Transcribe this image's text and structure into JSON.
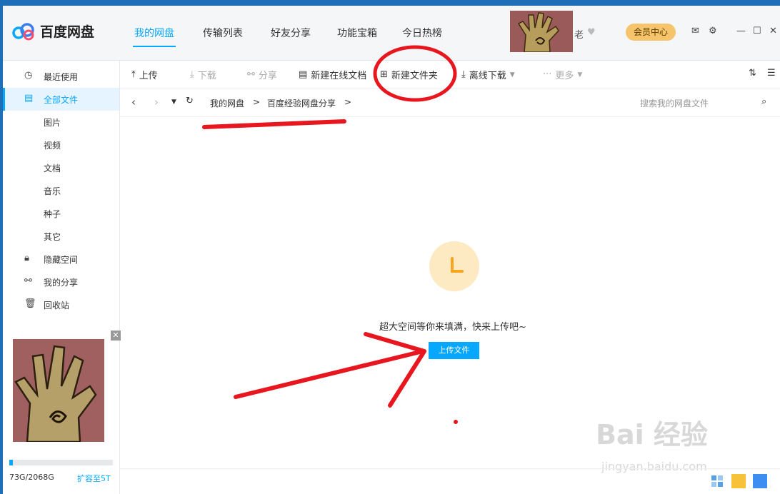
{
  "app": {
    "title": "百度网盘"
  },
  "nav": {
    "tabs": [
      "我的网盘",
      "传输列表",
      "好友分享",
      "功能宝箱",
      "今日热榜"
    ],
    "active": 0
  },
  "user": {
    "name": "老",
    "member_button": "会员中心"
  },
  "toolbar": {
    "upload": "上传",
    "download": "下载",
    "share": "分享",
    "new_doc": "新建在线文档",
    "new_folder": "新建文件夹",
    "offline_download": "离线下载",
    "more": "更多"
  },
  "path": {
    "crumbs": [
      "我的网盘",
      "百度经验网盘分享"
    ],
    "search_placeholder": "搜索我的网盘文件"
  },
  "sidebar": {
    "items": [
      {
        "label": "最近使用",
        "icon": "clock-icon"
      },
      {
        "label": "全部文件",
        "icon": "file-icon",
        "active": true
      },
      {
        "label": "图片"
      },
      {
        "label": "视频"
      },
      {
        "label": "文档"
      },
      {
        "label": "音乐"
      },
      {
        "label": "种子"
      },
      {
        "label": "其它"
      },
      {
        "label": "隐藏空间",
        "icon": "lock-icon"
      },
      {
        "label": "我的分享",
        "icon": "share-icon"
      },
      {
        "label": "回收站",
        "icon": "trash-icon"
      }
    ],
    "quota": {
      "used": "73G/2068G",
      "expand_link": "扩容至5T",
      "fraction": 0.035
    }
  },
  "main": {
    "empty_message": "超大空间等你来填满，快来上传吧~",
    "upload_button": "上传文件"
  },
  "watermark": {
    "text": "Bai 经验",
    "url": "jingyan.baidu.com"
  },
  "colors": {
    "accent": "#06a7ff",
    "member": "#f5c46b",
    "annotation": "#e8161e"
  }
}
